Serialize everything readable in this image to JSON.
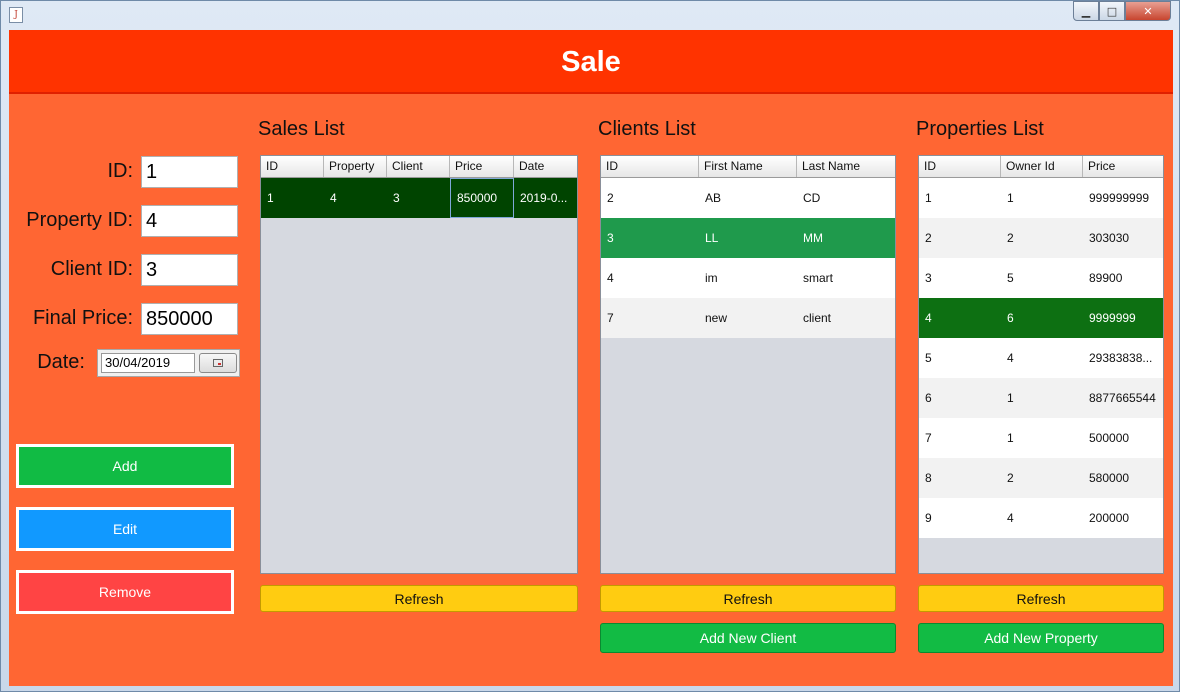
{
  "window": {
    "icon_label": "J",
    "minimize_label": "▁",
    "maximize_label": "□",
    "close_label": "✕"
  },
  "header": {
    "title": "Sale"
  },
  "form": {
    "id_label": "ID:",
    "id_value": "1",
    "property_label": "Property ID:",
    "property_value": "4",
    "client_label": "Client ID:",
    "client_value": "3",
    "price_label": "Final Price:",
    "price_value": "850000",
    "date_label": "Date:",
    "date_value": "30/04/2019"
  },
  "actions": {
    "add": "Add",
    "edit": "Edit",
    "remove": "Remove"
  },
  "colors": {
    "header": "#ff3300",
    "panel": "#ff6633",
    "add": "#11bb44",
    "edit": "#1199ff",
    "remove": "#ff4444",
    "refresh": "#ffcc11"
  },
  "sales": {
    "title": "Sales List",
    "columns": [
      "ID",
      "Property",
      "Client",
      "Price",
      "Date"
    ],
    "rows": [
      [
        "1",
        "4",
        "3",
        "850000",
        "2019-0..."
      ]
    ],
    "refresh": "Refresh"
  },
  "clients": {
    "title": "Clients List",
    "columns": [
      "ID",
      "First Name",
      "Last Name"
    ],
    "rows": [
      [
        "2",
        "AB",
        "CD"
      ],
      [
        "3",
        "LL",
        "MM"
      ],
      [
        "4",
        "im",
        "smart"
      ],
      [
        "7",
        "new",
        "client"
      ]
    ],
    "refresh": "Refresh",
    "add_new": "Add New Client"
  },
  "properties": {
    "title": "Properties List",
    "columns": [
      "ID",
      "Owner Id",
      "Price"
    ],
    "rows": [
      [
        "1",
        "1",
        "999999999"
      ],
      [
        "2",
        "2",
        "303030"
      ],
      [
        "3",
        "5",
        "89900"
      ],
      [
        "4",
        "6",
        "9999999"
      ],
      [
        "5",
        "4",
        "29383838..."
      ],
      [
        "6",
        "1",
        "8877665544"
      ],
      [
        "7",
        "1",
        "500000"
      ],
      [
        "8",
        "2",
        "580000"
      ],
      [
        "9",
        "4",
        "200000"
      ]
    ],
    "refresh": "Refresh",
    "add_new": "Add New Property"
  }
}
